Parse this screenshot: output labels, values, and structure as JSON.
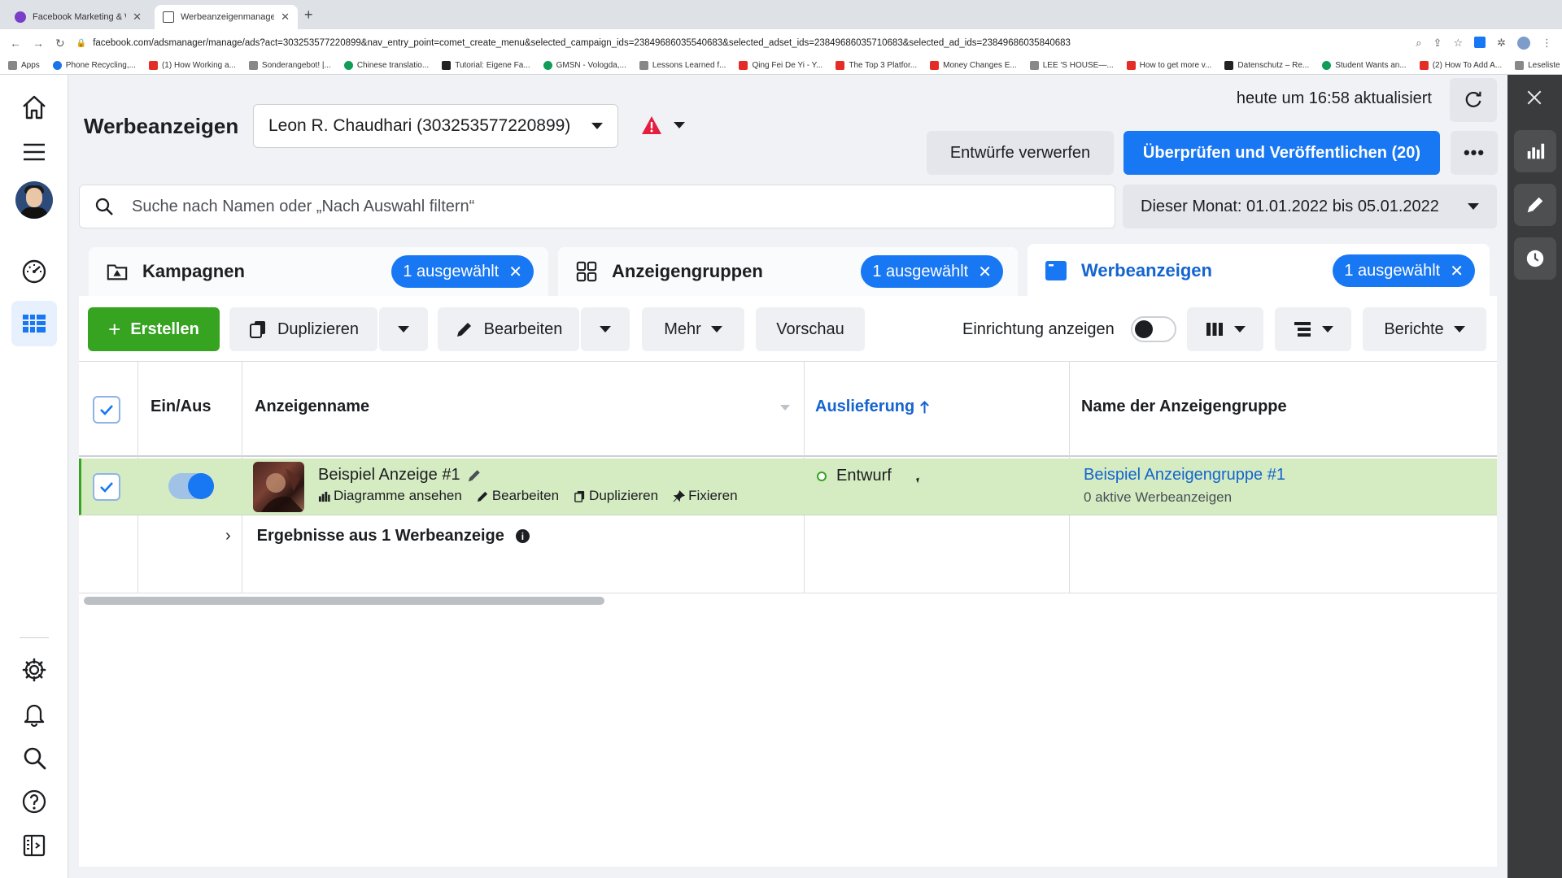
{
  "browser": {
    "tabs": [
      {
        "title": "Facebook Marketing & Werbea",
        "active": false
      },
      {
        "title": "Werbeanzeigenmanager - Wer",
        "active": true
      }
    ],
    "url": "facebook.com/adsmanager/manage/ads?act=303253577220899&nav_entry_point=comet_create_menu&selected_campaign_ids=23849686035540683&selected_adset_ids=23849686035710683&selected_ad_ids=23849686035840683",
    "bookmarks": [
      "Apps",
      "Phone Recycling,...",
      "(1) How Working a...",
      "Sonderangebot! |...",
      "Chinese translatio...",
      "Tutorial: Eigene Fa...",
      "GMSN - Vologda,...",
      "Lessons Learned f...",
      "Qing Fei De Yi - Y...",
      "The Top 3 Platfor...",
      "Money Changes E...",
      "LEE 'S HOUSE—...",
      "How to get more v...",
      "Datenschutz – Re...",
      "Student Wants an...",
      "(2) How To Add A..."
    ],
    "reading_list": "Leseliste"
  },
  "header": {
    "title": "Werbeanzeigen",
    "account": "Leon R. Chaudhari (303253577220899)",
    "updated": "heute um 16:58 aktualisiert",
    "discard_label": "Entwürfe verwerfen",
    "publish_label": "Überprüfen und Veröffentlichen (20)",
    "more_label": "•••"
  },
  "search": {
    "placeholder": "Suche nach Namen oder „Nach Auswahl filtern“",
    "value": ""
  },
  "date_range": "Dieser Monat: 01.01.2022 bis 05.01.2022",
  "levels": [
    {
      "label": "Kampagnen",
      "chip": "1 ausgewählt",
      "active": false
    },
    {
      "label": "Anzeigengruppen",
      "chip": "1 ausgewählt",
      "active": false
    },
    {
      "label": "Werbeanzeigen",
      "chip": "1 ausgewählt",
      "active": true
    }
  ],
  "actions": {
    "create": "Erstellen",
    "duplicate": "Duplizieren",
    "edit": "Bearbeiten",
    "more": "Mehr",
    "preview": "Vorschau",
    "setup_toggle": "Einrichtung anzeigen",
    "reports": "Berichte"
  },
  "table": {
    "headers": {
      "onoff": "Ein/Aus",
      "name": "Anzeigenname",
      "delivery": "Auslieferung",
      "adset": "Name der Anzeigengruppe"
    },
    "rows": [
      {
        "name": "Beispiel Anzeige #1",
        "actions": [
          "Diagramme ansehen",
          "Bearbeiten",
          "Duplizieren",
          "Fixieren"
        ],
        "status": "Entwurf",
        "adset": "Beispiel Anzeigengruppe #1",
        "adset_sub": "0 aktive Werbeanzeigen"
      }
    ],
    "results": "Ergebnisse aus 1 Werbeanzeige"
  },
  "colors": {
    "primary": "#1877f2",
    "create_green": "#36a420",
    "selected_row": "#d5ecc2"
  }
}
